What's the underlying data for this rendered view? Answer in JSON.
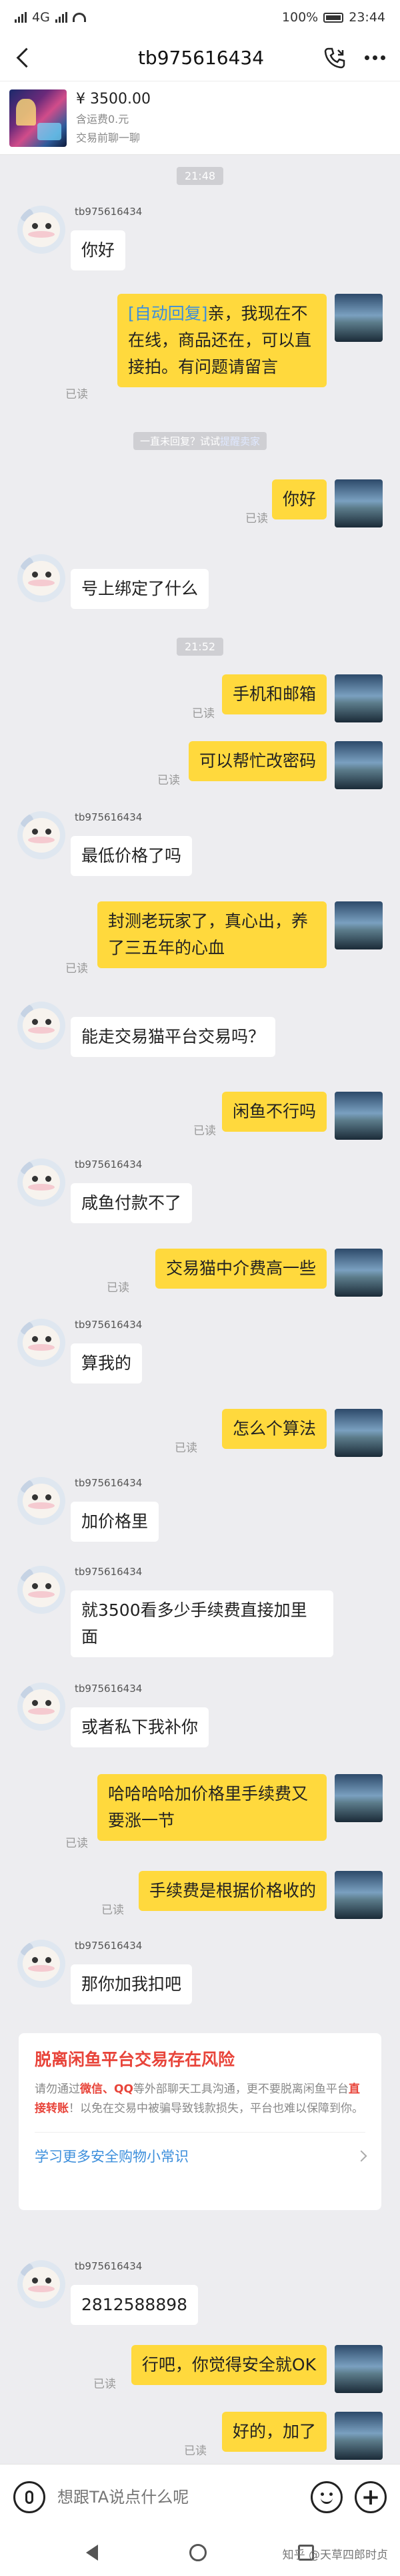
{
  "status_bar": {
    "left_text": "4G",
    "battery": "100%",
    "time": "23:44"
  },
  "header": {
    "title": "tb975616434"
  },
  "item": {
    "price": "¥ 3500.00",
    "shipping": "含运费0.元",
    "status": "交易前聊一聊"
  },
  "messages": {
    "time1": "21:48",
    "time2": "21:52",
    "sender_name": "tb975616434",
    "read_label": "已读",
    "m1": "你好",
    "m2_tag": "[自动回复]",
    "m2_body": "亲，我现在不在线，商品还在，可以直接拍。有问题请留言",
    "notice_prefix": "一直未回复？试试",
    "notice_link": "提醒卖家",
    "m3": "你好",
    "m4": "号上绑定了什么",
    "m5": "手机和邮箱",
    "m6": "可以帮忙改密码",
    "m7": "最低价格了吗",
    "m8": "封测老玩家了，真心出，养了三五年的心血",
    "m9": "能走交易猫平台交易吗？",
    "m10": "闲鱼不行吗",
    "m11": "咸鱼付款不了",
    "m12": "交易猫中介费高一些",
    "m13": "算我的",
    "m14": "怎么个算法",
    "m15": "加价格里",
    "m16": "就3500看多少手续费直接加里面",
    "m17": "或者私下我补你",
    "m18": "哈哈哈哈加价格里手续费又要涨一节",
    "m19": "手续费是根据价格收的",
    "m20": "那你加我扣吧",
    "m21": "2812588898",
    "m22": "行吧，你觉得安全就OK",
    "m23": "好的，加了"
  },
  "risk": {
    "title": "脱离闲鱼平台交易存在风险",
    "body_1": "请勿通过",
    "body_hl_1": "微信、QQ",
    "body_2": "等外部聊天工具沟通，更不要脱离闲鱼平台",
    "body_hl_2": "直接转账",
    "body_3": "！以免在交易中被骗导致钱款损失，平台也难以保障到你。",
    "link": "学习更多安全购物小常识"
  },
  "input": {
    "placeholder": "想跟TA说点什么呢"
  },
  "watermark": "知乎 @天草四郎时贞"
}
